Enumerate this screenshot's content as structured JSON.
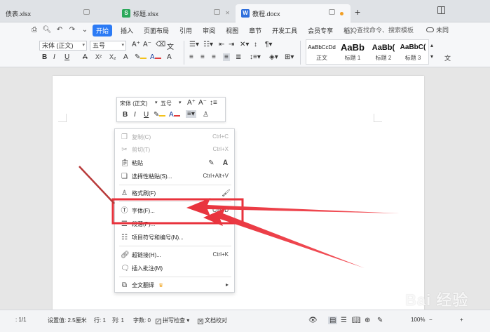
{
  "tabs": [
    {
      "label": "债表.xlsx",
      "type": "xlsx"
    },
    {
      "label": "标题.xlsx",
      "type": "xlsx"
    },
    {
      "label": "教程.docx",
      "type": "docx"
    }
  ],
  "menu": {
    "items": [
      "开始",
      "插入",
      "页面布局",
      "引用",
      "审阅",
      "视图",
      "章节",
      "开发工具",
      "会员专享",
      "稻》"
    ],
    "active": "开始",
    "search_placeholder": "Q查找命令、搜索模板",
    "cloud_label": "未同"
  },
  "ribbon": {
    "font_name": "宋体 (正文)",
    "font_size": "五号",
    "bold": "B",
    "italic": "I",
    "underline": "U",
    "strike": "A",
    "superscript": "X²",
    "subscript": "X₂",
    "style_previews": [
      {
        "preview": "AaBbCcDd",
        "label": "正文"
      },
      {
        "preview": "AaBb",
        "label": "标题 1"
      },
      {
        "preview": "AaBb(",
        "label": "标题 2"
      },
      {
        "preview": "AaBbC(",
        "label": "标题 3"
      }
    ],
    "side_label": "文"
  },
  "minibar": {
    "font": "宋体 (正文)",
    "size": "五号",
    "bold": "B",
    "italic": "I",
    "underline": "U"
  },
  "context_menu": [
    {
      "label": "复制(C)",
      "shortcut": "Ctrl+C",
      "icon": "copy-icon",
      "disabled": true
    },
    {
      "label": "剪切(T)",
      "shortcut": "Ctrl+X",
      "icon": "cut-icon",
      "disabled": true
    },
    {
      "label": "粘贴",
      "shortcut": "",
      "icon": "paste-icon",
      "disabled": false
    },
    {
      "label": "选择性粘贴(S)...",
      "shortcut": "Ctrl+Alt+V",
      "icon": "paste-special-icon",
      "disabled": false
    },
    {
      "label": "格式刷(F)",
      "shortcut": "",
      "icon": "format-painter-icon",
      "disabled": false
    },
    {
      "label": "字体(F)...",
      "shortcut": "Ctrl+D",
      "icon": "font-icon",
      "disabled": false
    },
    {
      "label": "段落(P)...",
      "shortcut": "",
      "icon": "paragraph-icon",
      "disabled": false
    },
    {
      "label": "项目符号和编号(N)...",
      "shortcut": "",
      "icon": "bullets-icon",
      "disabled": false
    },
    {
      "label": "超链接(H)...",
      "shortcut": "Ctrl+K",
      "icon": "hyperlink-icon",
      "disabled": false
    },
    {
      "label": "插入批注(M)",
      "shortcut": "",
      "icon": "comment-icon",
      "disabled": false
    },
    {
      "label": "全文翻译",
      "shortcut": "",
      "icon": "translate-icon",
      "disabled": false
    }
  ],
  "status": {
    "page": "1/1",
    "setting": "设置值: 2.5厘米",
    "row": "行: 1",
    "col": "列: 1",
    "word_count": "字数: 0",
    "spell_check": "拼写检查",
    "doc_proof": "文档校对",
    "zoom": "100%"
  },
  "watermark": "Bai 经验",
  "colors": {
    "accent": "#2c7bf5",
    "annotation": "#e8323c"
  }
}
